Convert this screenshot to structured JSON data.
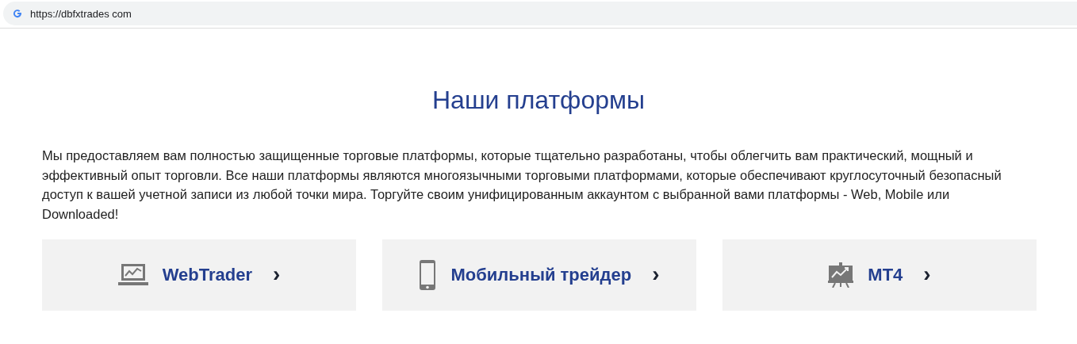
{
  "address_bar": {
    "url": "https://dbfxtrades com"
  },
  "heading": "Наши платформы",
  "intro": "Мы предоставляем вам полностью защищенные торговые платформы, которые тщательно разработаны, чтобы облегчить вам практический, мощный и эффективный опыт торговли. Все наши платформы являются многоязычными торговыми платформами, которые обеспечивают круглосуточный безопасный доступ к вашей учетной записи из любой точки мира. Торгуйте своим унифицированным аккаунтом с выбранной вами платформы - Web, Mobile или Downloaded!",
  "platforms": [
    {
      "kind": "laptop",
      "label": "WebTrader",
      "arrow": "›"
    },
    {
      "kind": "phone",
      "label": "Мобильный трейдер",
      "arrow": "›"
    },
    {
      "kind": "board",
      "label": "MT4",
      "arrow": "›"
    }
  ]
}
